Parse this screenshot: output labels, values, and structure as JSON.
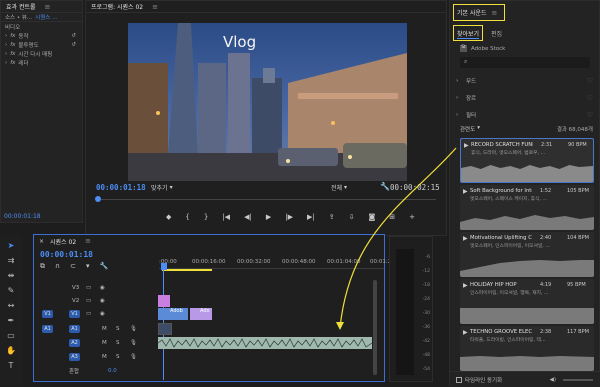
{
  "effect_controls": {
    "tab_label": "효과 컨트롤",
    "source_label": "소스 • 뷰...",
    "sequence_label": "시퀀스 ...",
    "section_label": "비디오",
    "items": [
      {
        "label": "동작"
      },
      {
        "label": "불투명도"
      },
      {
        "label": "시간 다시 매핑"
      },
      {
        "label": "레더"
      }
    ],
    "timecode": "00:00:01:18"
  },
  "program_monitor": {
    "tab_label": "프로그램: 시퀀스 02",
    "overlay_title": "Vlog",
    "current_time": "00:00:01:18",
    "fit_label": "맞추기",
    "resolution_label": "전체",
    "duration": "00:00:02:15"
  },
  "timeline": {
    "tab_label": "시퀀스 02",
    "timecode": "00:00:01:18",
    "ruler_labels": [
      ":00:00",
      "00:00:16:00",
      "00:00:32:00",
      "00:00:48:00",
      "00:01:04:00",
      "00:01:20:00"
    ],
    "tracks": [
      {
        "name": "V3",
        "type": "video"
      },
      {
        "name": "V2",
        "type": "video"
      },
      {
        "name": "V1",
        "type": "video",
        "target": "V1"
      },
      {
        "name": "A1",
        "type": "audio",
        "target": "A1"
      },
      {
        "name": "A2",
        "type": "audio"
      },
      {
        "name": "A3",
        "type": "audio"
      }
    ],
    "mix_label": "혼합",
    "mix_value": "0.0",
    "clips": [
      {
        "label": "Adob"
      },
      {
        "label": "Ado"
      }
    ]
  },
  "audio_meter": {
    "db_labels": [
      "-6",
      "-12",
      "-18",
      "-24",
      "-30",
      "-36",
      "-42",
      "-48",
      "-54"
    ]
  },
  "essential_sound": {
    "tab_label": "기본 사운드",
    "subtab_browse": "찾아보기",
    "subtab_edit": "편집",
    "source_label": "Adobe Stock",
    "filters": [
      {
        "label": "무드"
      },
      {
        "label": "장르"
      },
      {
        "label": "필터"
      }
    ],
    "sort_label": "관련도",
    "results_count": "결과 68,048개",
    "tracks": [
      {
        "title": "RECORD SCRATCH FUNK...",
        "tags": "휴식, 드라마, 엣모스페어, 범로우, ...",
        "duration": "2:31",
        "bpm": "90 BPM",
        "selected": true
      },
      {
        "title": "Soft Background for Interview",
        "tags": "엣모스페어, 스페이스 케이지, 휴식, ...",
        "duration": "1:52",
        "bpm": "105 BPM",
        "selected": false
      },
      {
        "title": "Motivational Uplifting Corpo...",
        "tags": "엣모스페어, 인스파이어링, 이모셔널, ...",
        "duration": "2:40",
        "bpm": "104 BPM",
        "selected": false
      },
      {
        "title": "HOLIDAY HIP HOP",
        "tags": "인스파이어링, 이모셔널, 행복, 재치, ...",
        "duration": "4:19",
        "bpm": "95 BPM",
        "selected": false
      },
      {
        "title": "TECHNO GROOVE ELECTRO",
        "tags": "타워풀, 드라이빙, 인스파이어링, 테...",
        "duration": "2:38",
        "bpm": "117 BPM",
        "selected": false
      }
    ],
    "footer_label": "타임라인 동기화"
  },
  "colors": {
    "accent_blue": "#4c8df6",
    "highlight_yellow": "#f0e039",
    "clip_purple": "#c97fe0",
    "clip_audio": "#9fb9ae"
  }
}
